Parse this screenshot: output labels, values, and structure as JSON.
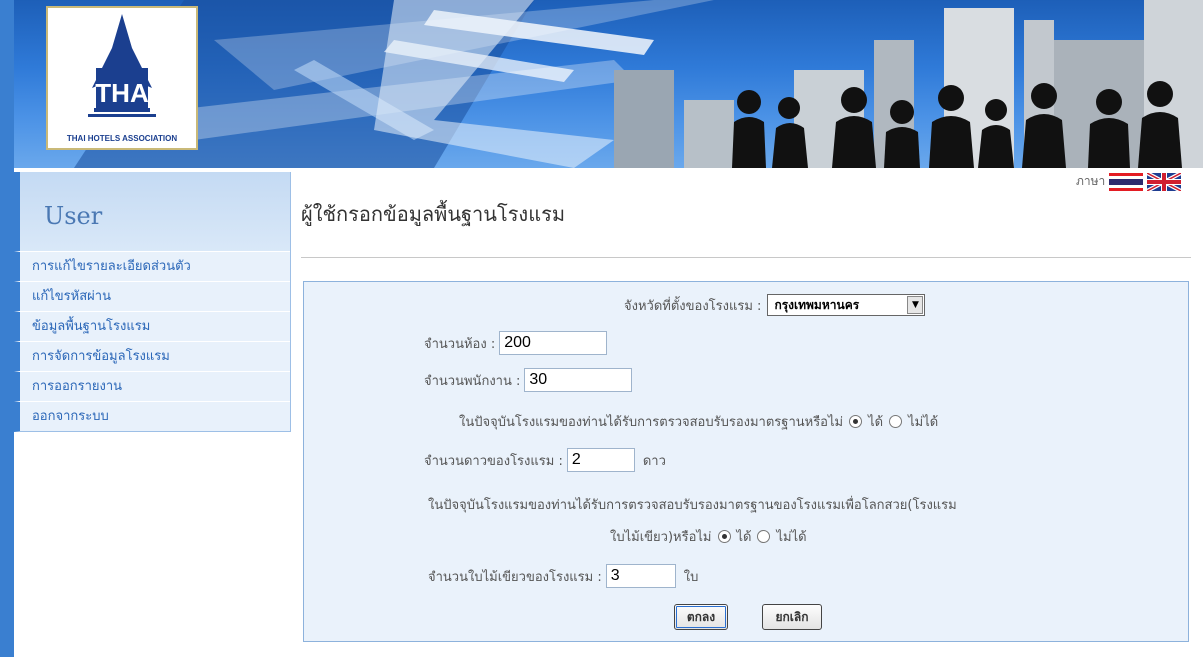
{
  "header": {
    "logo_abbrev": "THA",
    "logo_name": "THAI HOTELS ASSOCIATION"
  },
  "language": {
    "label": "ภาษา",
    "flags": [
      "thai-flag-icon",
      "uk-flag-icon"
    ]
  },
  "sidebar": {
    "title": "User",
    "items": [
      {
        "label": "การแก้ไขรายละเอียดส่วนตัว"
      },
      {
        "label": "แก้ไขรหัสผ่าน"
      },
      {
        "label": "ข้อมูลพื้นฐานโรงแรม"
      },
      {
        "label": "การจัดการข้อมูลโรงแรม"
      },
      {
        "label": "การออกรายงาน"
      },
      {
        "label": "ออกจากระบบ"
      }
    ]
  },
  "main": {
    "title": "ผู้ใช้กรอกข้อมูลพื้นฐานโรงแรม"
  },
  "form": {
    "province_label": "จังหวัดที่ตั้งของโรงแรม :",
    "province_value": "กรุงเทพมหานคร",
    "rooms_label": "จำนวนห้อง :",
    "rooms_value": "200",
    "staff_label": "จำนวนพนักงาน :",
    "staff_value": "30",
    "cert_question": "ในปัจจุบันโรงแรมของท่านได้รับการตรวจสอบรับรองมาตรฐานหรือไม่",
    "cert_yes": "ได้",
    "cert_no": "ไม่ได้",
    "cert_selected": "yes",
    "stars_label": "จำนวนดาวของโรงแรม :",
    "stars_value": "2",
    "stars_unit": "ดาว",
    "green_question_line1": "ในปัจจุบันโรงแรมของท่านได้รับการตรวจสอบรับรองมาตรฐานของโรงแรมเพื่อโลกสวย(โรงแรม",
    "green_question_line2": "ใบไม้เขียว)หรือไม่",
    "green_yes": "ได้",
    "green_no": "ไม่ได้",
    "green_selected": "yes",
    "leaves_label": "จำนวนใบไม้เขียวของโรงแรม :",
    "leaves_value": "3",
    "leaves_unit": "ใบ",
    "ok_label": "ตกลง",
    "cancel_label": "ยกเลิก"
  },
  "colors": {
    "accent": "#3a7fd0",
    "menu_text": "#2b67b8",
    "form_bg": "#eaf2fb",
    "form_border": "#8db2dc"
  }
}
